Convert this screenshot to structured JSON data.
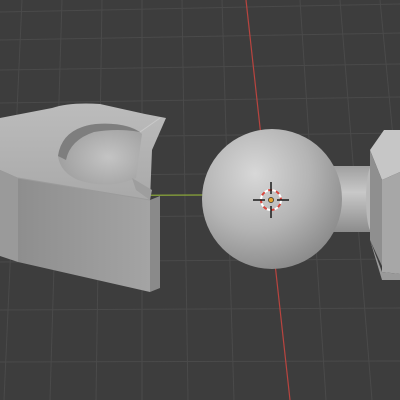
{
  "viewport": {
    "background": "#3d3d3d",
    "grid_line_color": "#4a4a4a",
    "axis_x_color": "#8aa63a",
    "axis_y_color": "#b9443f",
    "model_color": "#b0b0b0"
  },
  "scene_objects": [
    "socket-clamp",
    "ball-joint",
    "connector-part"
  ],
  "cursor": "3d-cursor-icon"
}
